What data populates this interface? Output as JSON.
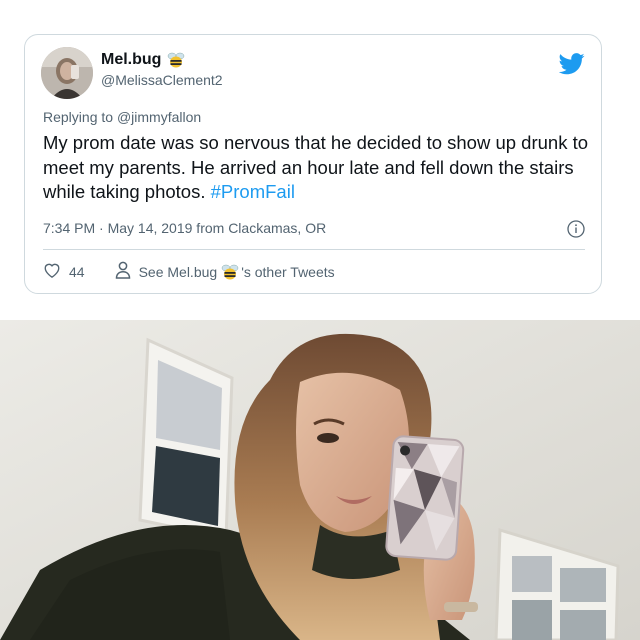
{
  "tweet": {
    "display_name": "Mel.bug",
    "handle": "@MelissaClement2",
    "replying_prefix": "Replying to",
    "replying_to": "@jimmyfallon",
    "text": "My prom date was so nervous that he decided to show up drunk to meet my parents. He arrived an hour late and fell down the stairs while taking photos.",
    "hashtag": "#PromFail",
    "timestamp": "7:34 PM · May 14, 2019 from Clackamas, OR",
    "like_count": "44",
    "see_other_prefix": "See Mel.bug",
    "see_other_suffix": "'s other Tweets",
    "icons": {
      "brand": "twitter-bird-icon",
      "badge": "bee-emoji",
      "info": "info-icon",
      "like": "heart-icon",
      "profile": "person-icon"
    },
    "colors": {
      "accent": "#1d9bf0",
      "text": "#0f1419",
      "muted": "#536471"
    }
  },
  "photo": {
    "description_icon": "selfie-photo"
  }
}
